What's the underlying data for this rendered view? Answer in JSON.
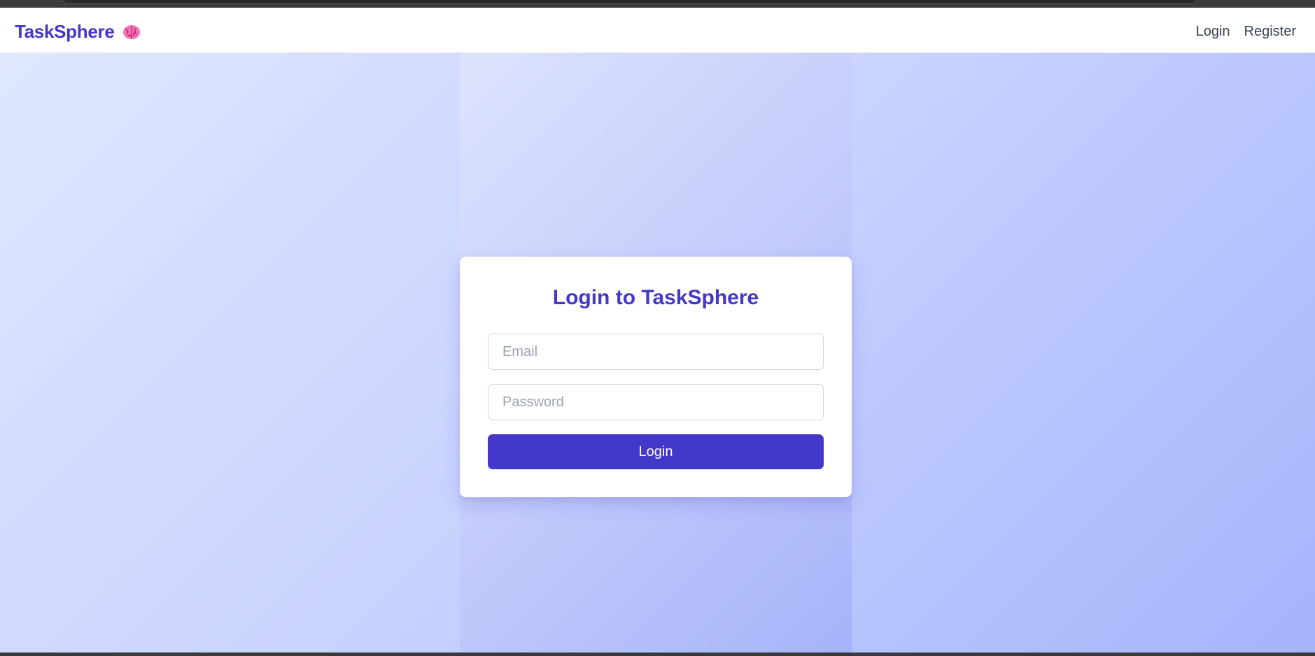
{
  "navbar": {
    "brand": "TaskSphere",
    "brand_icon": "brain-icon",
    "links": [
      "Login",
      "Register"
    ]
  },
  "login_form": {
    "title": "Login to TaskSphere",
    "email_placeholder": "Email",
    "email_value": "",
    "password_placeholder": "Password",
    "password_value": "",
    "submit_label": "Login"
  },
  "colors": {
    "brand": "#4338ca",
    "button_bg": "#4338ca",
    "background_gradient": [
      "#e0e7ff",
      "#a5b4fc"
    ]
  }
}
